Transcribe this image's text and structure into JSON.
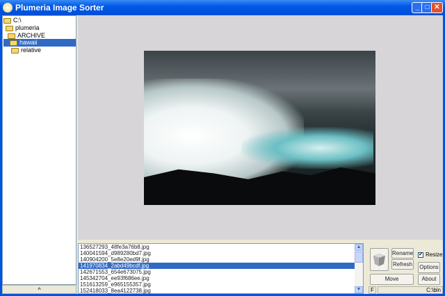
{
  "window": {
    "title": "Plumeria Image Sorter"
  },
  "tree": {
    "nodes": [
      {
        "label": "C:\\",
        "level": 0
      },
      {
        "label": "plumeria",
        "level": 1
      },
      {
        "label": "ARCHIVE",
        "level": 2
      },
      {
        "label": "hawaii",
        "level": 2,
        "selected": true
      },
      {
        "label": "relative",
        "level": 3
      }
    ],
    "collapse_label": "^"
  },
  "files": [
    "136527293_48fe3a76b8.jpg",
    "140041594_d989280bd7.jpg",
    "140904200_5e8e20ed9f.jpg",
    "141970834_2abd49bcdf.jpg",
    "142671553_654e673075.jpg",
    "145342704_ee93f686ee.jpg",
    "151613259_e965155357.jpg",
    "152418033_8ea4122738.jpg"
  ],
  "selected_file_index": 3,
  "controls": {
    "rename": "Rename",
    "refresh": "Refresh",
    "move": "Move",
    "options": "Options",
    "about": "About",
    "resize": "Resize",
    "resize_checked": true
  },
  "status": {
    "left": "F",
    "right": "C:\\bin"
  }
}
